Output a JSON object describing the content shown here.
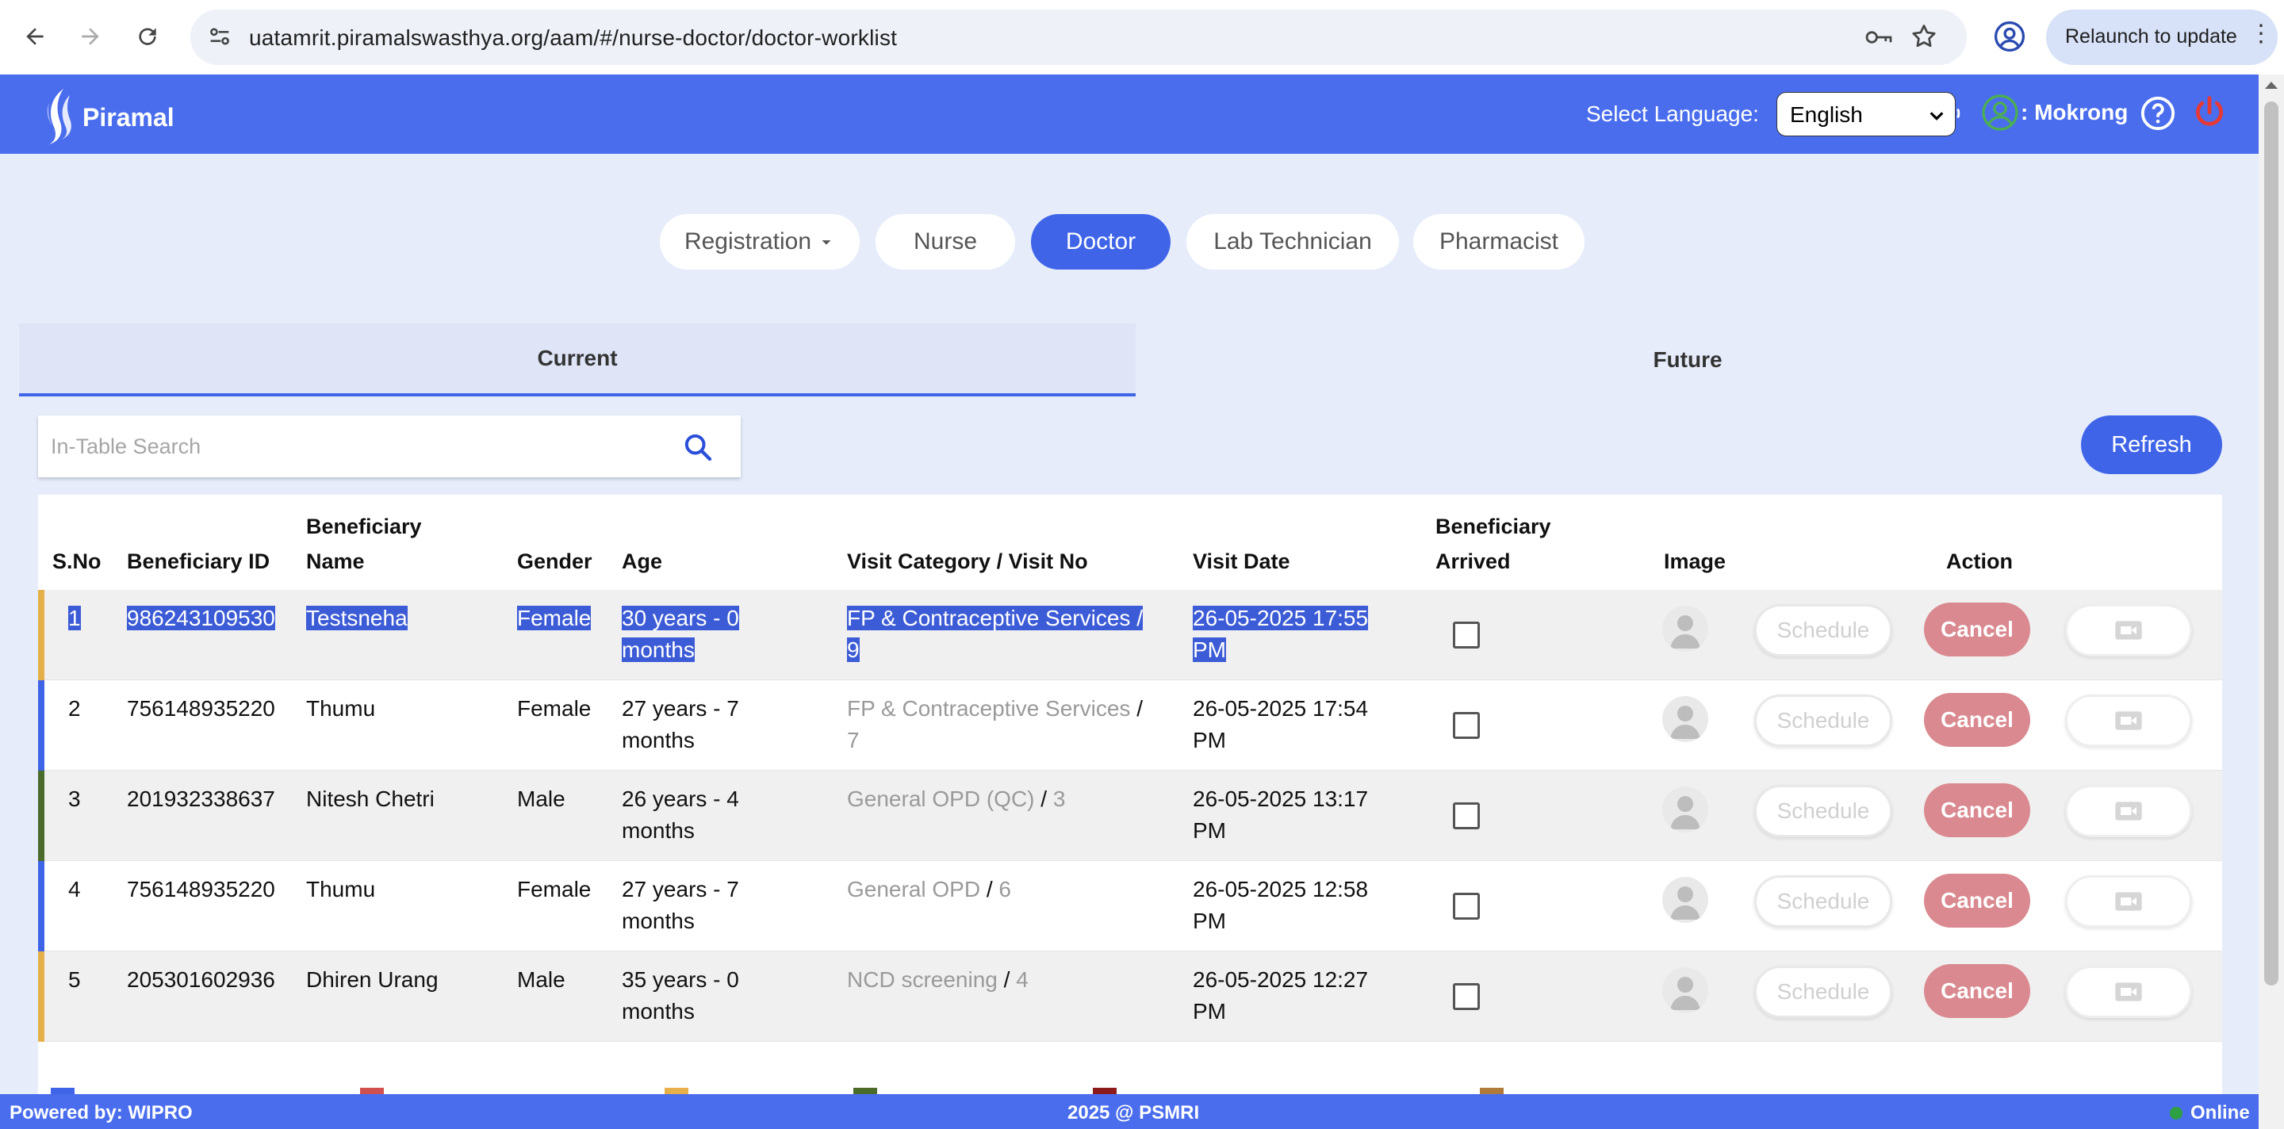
{
  "browser": {
    "url": "uatamrit.piramalswasthya.org/aam/#/nurse-doctor/doctor-worklist",
    "relaunch_label": "Relaunch to update"
  },
  "header": {
    "logo_text": "Piramal",
    "language_label": "Select Language:",
    "language_value": "English",
    "user_name": ": Mokrong"
  },
  "roles": [
    "Registration",
    "Nurse",
    "Doctor",
    "Lab Technician",
    "Pharmacist"
  ],
  "active_role": "Doctor",
  "tabs": {
    "current": "Current",
    "future": "Future"
  },
  "search": {
    "placeholder": "In-Table Search"
  },
  "refresh_label": "Refresh",
  "table": {
    "headers": {
      "sno": "S.No",
      "id": "Beneficiary ID",
      "name_1": "Beneficiary",
      "name_2": "Name",
      "gender": "Gender",
      "age": "Age",
      "visit": "Visit Category / Visit No",
      "date": "Visit Date",
      "arrived_1": "Beneficiary",
      "arrived_2": "Arrived",
      "image": "Image",
      "action": "Action"
    },
    "schedule_label": "Schedule",
    "cancel_label": "Cancel",
    "rows": [
      {
        "sno": "1",
        "id": "986243109530",
        "name": "Testsneha",
        "gender": "Female",
        "age_1": "30 years - 0",
        "age_2": "months",
        "visit_category": "FP & Contraceptive Services /",
        "visit_no": "9",
        "date_1": "26-05-2025 17:55",
        "date_2": "PM",
        "color": "#e5b04a"
      },
      {
        "sno": "2",
        "id": "756148935220",
        "name": "Thumu",
        "gender": "Female",
        "age_1": "27 years - 7",
        "age_2": "months",
        "visit_category": "FP & Contraceptive Services",
        "visit_sep": " /",
        "visit_no": "7",
        "date_1": "26-05-2025 17:54",
        "date_2": "PM",
        "color": "#3f64e8"
      },
      {
        "sno": "3",
        "id": "201932338637",
        "name": "Nitesh Chetri",
        "gender": "Male",
        "age_1": "26 years - 4",
        "age_2": "months",
        "visit_category": "General OPD (QC)",
        "visit_sep": " / ",
        "visit_no": "3",
        "date_1": "26-05-2025 13:17",
        "date_2": "PM",
        "color": "#4a6b2a"
      },
      {
        "sno": "4",
        "id": "756148935220",
        "name": "Thumu",
        "gender": "Female",
        "age_1": "27 years - 7",
        "age_2": "months",
        "visit_category": "General OPD",
        "visit_sep": " / ",
        "visit_no": "6",
        "date_1": "26-05-2025 12:58",
        "date_2": "PM",
        "color": "#3f64e8"
      },
      {
        "sno": "5",
        "id": "205301602936",
        "name": "Dhiren Urang",
        "gender": "Male",
        "age_1": "35 years - 0",
        "age_2": "months",
        "visit_category": "NCD screening",
        "visit_sep": " / ",
        "visit_no": "4",
        "date_1": "26-05-2025 12:27",
        "date_2": "PM",
        "color": "#e5b04a"
      }
    ]
  },
  "footer": {
    "left": "Powered by: WIPRO",
    "center": "2025 @ PSMRI",
    "right": "Online"
  },
  "colors": {
    "header_blue": "#4a6ded",
    "accent": "#3f64e8",
    "cancel": "#d9898f"
  }
}
